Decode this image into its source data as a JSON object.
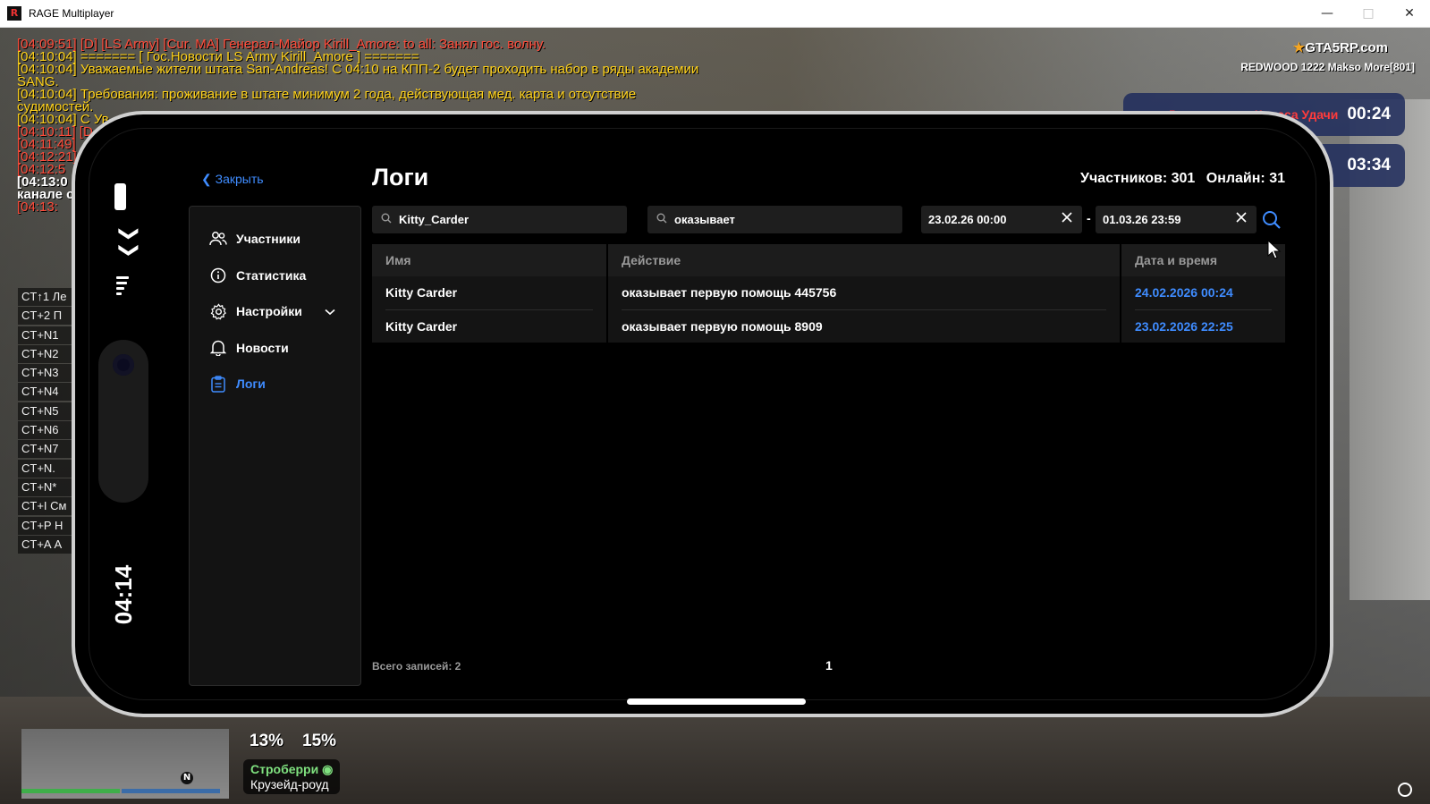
{
  "window": {
    "title": "RAGE Multiplayer",
    "app_icon": "R"
  },
  "chat": {
    "lines": [
      {
        "text": "[04:09:51] [D] [LS Army] [Cur. MA] Генерал-Майор Kirill_Amore: to all: Занял гос. волну.",
        "color": "red"
      },
      {
        "text": "[04:10:04] ======= [ Гос.Новости LS Army Kirill_Amore ] =======",
        "color": "yellow"
      },
      {
        "text": "[04:10:04] Уважаемые жители штата San-Andreas! С 04:10 на КПП-2 будет проходить набор в ряды академии",
        "color": "yellow"
      },
      {
        "text": "SANG.",
        "color": "yellow"
      },
      {
        "text": "[04:10:04] Требования: проживание в штате минимум 2 года, действующая мед. карта и отсутствие",
        "color": "yellow"
      },
      {
        "text": "судимостей.",
        "color": "yellow"
      },
      {
        "text": "[04:10:04] С Ув",
        "color": "yellow"
      },
      {
        "text": "[04:10:11] [D",
        "color": "red"
      },
      {
        "text": "[04:11:49]",
        "color": "red"
      },
      {
        "text": "[04:12:21]",
        "color": "red"
      },
      {
        "text": "[04:12:5",
        "color": "red"
      },
      {
        "text": "[04:13:0",
        "color": "white"
      },
      {
        "text": "канале с",
        "color": "white"
      },
      {
        "text": "[04:13:",
        "color": "red"
      }
    ]
  },
  "keyhints": [
    "CT↑1 Ле",
    "CT+2 П",
    "CT+N1",
    "CT+N2",
    "CT+N3",
    "CT+N4",
    "CT+N5",
    "CT+N6",
    "CT+N7",
    "CT+N.",
    "CT+N*",
    "CT+I См",
    "CT+P Н",
    "CT+A А"
  ],
  "hud": {
    "logo": "GTA5RP.com",
    "server": "REDWOOD 1222 Makso More[801]",
    "timers": [
      {
        "label": "До прокрутки Колеса Удачи",
        "time": "00:24"
      },
      {
        "label": "",
        "time": "03:34"
      }
    ],
    "health_pct": "13%",
    "armor_pct": "15%",
    "north": "N",
    "street": "Строберри",
    "area": "Крузейд-роуд"
  },
  "phone": {
    "clock": "04:14"
  },
  "app": {
    "back_label": "Закрыть",
    "title": "Логи",
    "members_label": "Участников: 301",
    "online_label": "Онлайн: 31",
    "nav": [
      {
        "label": "Участники",
        "icon": "users-icon"
      },
      {
        "label": "Статистика",
        "icon": "info-icon"
      },
      {
        "label": "Настройки",
        "icon": "gear-icon"
      },
      {
        "label": "Новости",
        "icon": "bell-icon"
      },
      {
        "label": "Логи",
        "icon": "clipboard-icon"
      }
    ],
    "filters": {
      "name": "Kitty_Carder",
      "action": "оказывает",
      "date_from": "23.02.26 00:00",
      "date_to": "01.03.26 23:59",
      "dash": "-"
    },
    "table": {
      "headers": [
        "Имя",
        "Действие",
        "Дата и время"
      ],
      "rows": [
        [
          "Kitty Carder",
          "оказывает первую помощь 445756",
          "24.02.2026 00:24"
        ],
        [
          "Kitty Carder",
          "оказывает первую помощь 8909",
          "23.02.2026 22:25"
        ]
      ]
    },
    "total_label": "Всего записей: 2",
    "page": "1"
  },
  "colors": {
    "accent": "#3f8cff",
    "panel": "#131313",
    "chat_red": "#ff4b3a",
    "chat_yellow": "#ffd21a"
  }
}
